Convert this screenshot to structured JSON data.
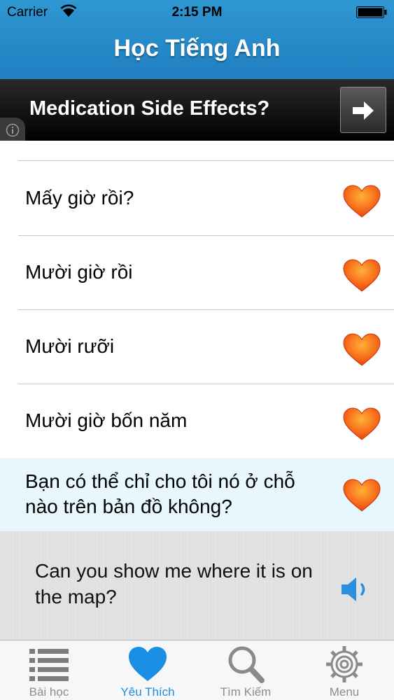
{
  "status": {
    "carrier": "Carrier",
    "time": "2:15 PM"
  },
  "header": {
    "title": "Học Tiếng Anh"
  },
  "ad": {
    "text": "Medication Side Effects?"
  },
  "list": {
    "items": [
      {
        "label": "Mấy giờ rồi?"
      },
      {
        "label": "Mười giờ rồi"
      },
      {
        "label": "Mười rưỡi"
      },
      {
        "label": "Mười giờ bốn năm"
      },
      {
        "label": "Bạn có thể chỉ cho tôi nó ở chỗ nào trên bản đồ không?"
      }
    ]
  },
  "detail": {
    "translation": "Can you show me where it is on the map?"
  },
  "tabs": [
    {
      "label": "Bài học",
      "icon": "list-icon"
    },
    {
      "label": "Yêu Thích",
      "icon": "heart-icon"
    },
    {
      "label": "Tìm Kiếm",
      "icon": "search-icon"
    },
    {
      "label": "Menu",
      "icon": "gear-icon"
    }
  ],
  "colors": {
    "header": "#2e97d2",
    "tab_active": "#1a8fe3",
    "heart": "#f25a14",
    "selected_row": "#e8f7fd"
  }
}
